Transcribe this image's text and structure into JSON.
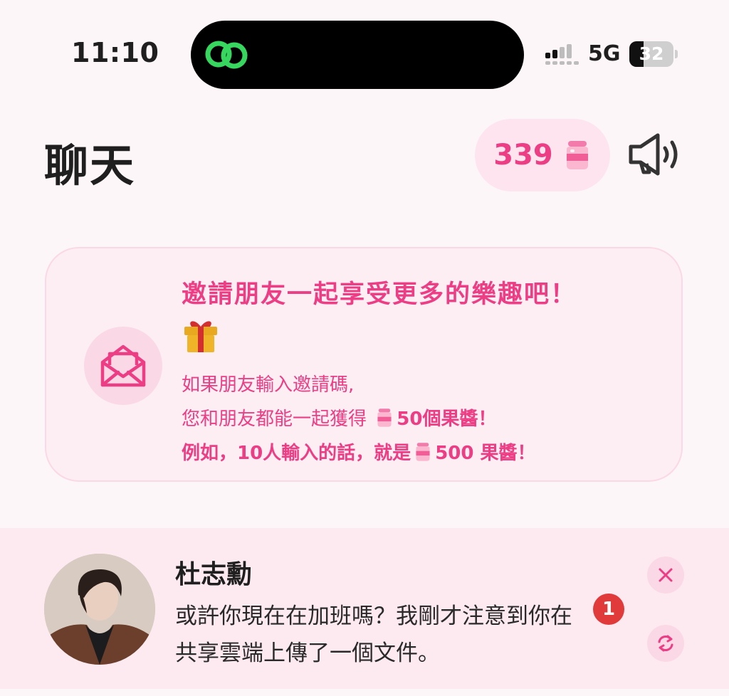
{
  "status_bar": {
    "time": "11:10",
    "network": "5G",
    "battery_percent": 32,
    "battery_label": "32"
  },
  "header": {
    "title": "聊天",
    "jam_count": "339"
  },
  "invite": {
    "title": "邀請朋友一起享受更多的樂趣吧！",
    "line1": "如果朋友輸入邀請碼,",
    "line2_prefix": "您和朋友都能一起獲得 ",
    "line2_amount": "50個果醬！",
    "line3_prefix": "例如，10人輸入的話，就是",
    "line3_amount": "500 果醬！"
  },
  "chat": {
    "name": "杜志勳",
    "message": "或許你現在在加班嗎？我剛才注意到你在共享雲端上傳了一個文件。",
    "unread_count": "1"
  },
  "colors": {
    "accent_pink": "#ec3d85",
    "pill_bg": "#fde4ee",
    "card_bg": "#fdeef4",
    "badge_red": "#e03a3a"
  },
  "icons": [
    "app-link-icon",
    "signal-icon",
    "battery-icon",
    "jam-jar-icon",
    "speaker-icon",
    "mail-icon",
    "gift-icon",
    "close-icon",
    "refresh-icon"
  ]
}
